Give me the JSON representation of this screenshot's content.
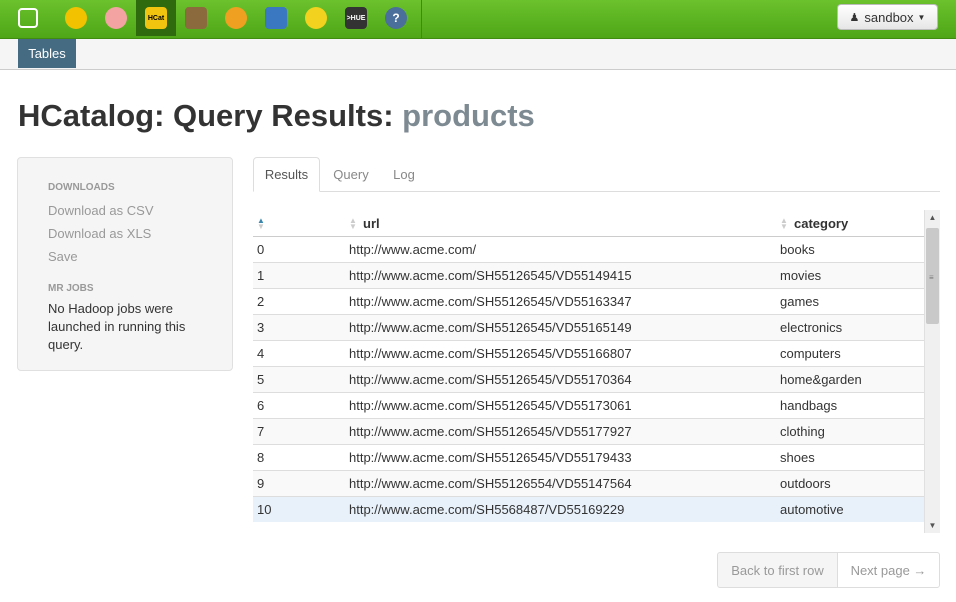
{
  "topbar": {
    "apps": [
      {
        "icon": "hue-logo-icon",
        "active": false,
        "color": "#ffffff"
      },
      {
        "icon": "beeswax-hive-icon",
        "active": false,
        "color": "#f2c200"
      },
      {
        "icon": "pig-icon",
        "active": false,
        "color": "#f4a3a3"
      },
      {
        "icon": "hcatalog-icon",
        "active": true,
        "color": "#f1c40f",
        "label": "HCat"
      },
      {
        "icon": "file-browser-icon",
        "active": false,
        "color": "#8b6b3e"
      },
      {
        "icon": "job-designer-icon",
        "active": false,
        "color": "#f0a020"
      },
      {
        "icon": "oozie-icon",
        "active": false,
        "color": "#3a78c2"
      },
      {
        "icon": "job-browser-icon",
        "active": false,
        "color": "#f2d21e"
      },
      {
        "icon": "shell-icon",
        "active": false,
        "color": "#333333",
        "label": ">HUE"
      },
      {
        "icon": "help-icon",
        "active": false,
        "color": "#4a6f9a",
        "label": "?"
      }
    ],
    "user_menu": "sandbox"
  },
  "subnav": {
    "tab": "Tables"
  },
  "title": {
    "prefix": "HCatalog: Query Results:",
    "table": "products"
  },
  "sidebar": {
    "downloads_header": "DOWNLOADS",
    "download_csv": "Download as CSV",
    "download_xls": "Download as XLS",
    "save": "Save",
    "mr_jobs_header": "MR JOBS",
    "mr_jobs_text": "No Hadoop jobs were launched in running this query."
  },
  "tabs": [
    "Results",
    "Query",
    "Log"
  ],
  "table": {
    "columns": [
      "",
      "url",
      "category"
    ],
    "rows": [
      [
        "0",
        "http://www.acme.com/",
        "books"
      ],
      [
        "1",
        "http://www.acme.com/SH55126545/VD55149415",
        "movies"
      ],
      [
        "2",
        "http://www.acme.com/SH55126545/VD55163347",
        "games"
      ],
      [
        "3",
        "http://www.acme.com/SH55126545/VD55165149",
        "electronics"
      ],
      [
        "4",
        "http://www.acme.com/SH55126545/VD55166807",
        "computers"
      ],
      [
        "5",
        "http://www.acme.com/SH55126545/VD55170364",
        "home&garden"
      ],
      [
        "6",
        "http://www.acme.com/SH55126545/VD55173061",
        "handbags"
      ],
      [
        "7",
        "http://www.acme.com/SH55126545/VD55177927",
        "clothing"
      ],
      [
        "8",
        "http://www.acme.com/SH55126545/VD55179433",
        "shoes"
      ],
      [
        "9",
        "http://www.acme.com/SH55126554/VD55147564",
        "outdoors"
      ],
      [
        "10",
        "http://www.acme.com/SH5568487/VD55169229",
        "automotive"
      ]
    ]
  },
  "pager": {
    "first": "Back to first row",
    "next": "Next page →"
  }
}
